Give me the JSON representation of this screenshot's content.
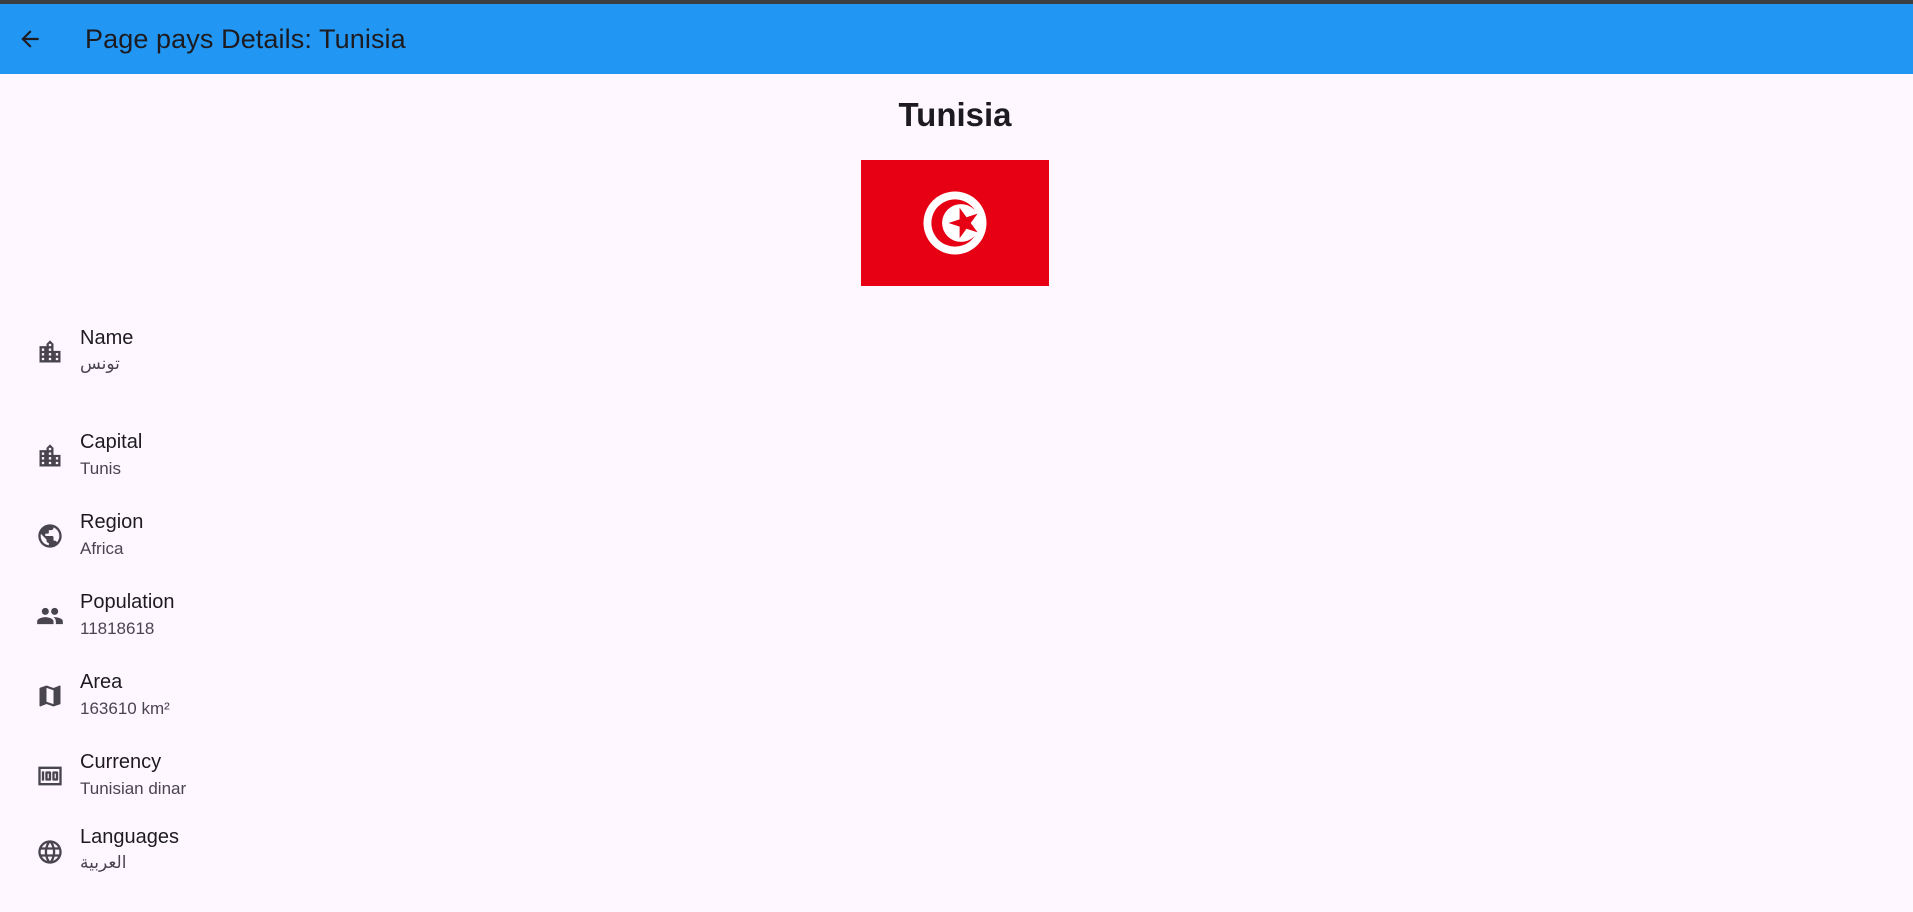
{
  "appbar": {
    "title": "Page pays Details: Tunisia",
    "back_icon": "arrow-back-icon"
  },
  "country": {
    "name": "Tunisia",
    "flag": {
      "red": "#e70013",
      "white": "#ffffff"
    }
  },
  "details": [
    {
      "icon": "location-city-icon",
      "label": "Name",
      "value": "تونس"
    },
    {
      "icon": "location-city-icon",
      "label": "Capital",
      "value": "Tunis"
    },
    {
      "icon": "public-icon",
      "label": "Region",
      "value": "Africa"
    },
    {
      "icon": "people-icon",
      "label": "Population",
      "value": "11818618"
    },
    {
      "icon": "map-icon",
      "label": "Area",
      "value": "163610 km²"
    },
    {
      "icon": "money-icon",
      "label": "Currency",
      "value": "Tunisian dinar"
    },
    {
      "icon": "language-icon",
      "label": "Languages",
      "value": "العربية"
    }
  ],
  "colors": {
    "appbar": "#2196f3",
    "background": "#fef7ff",
    "icon": "#49454f"
  }
}
